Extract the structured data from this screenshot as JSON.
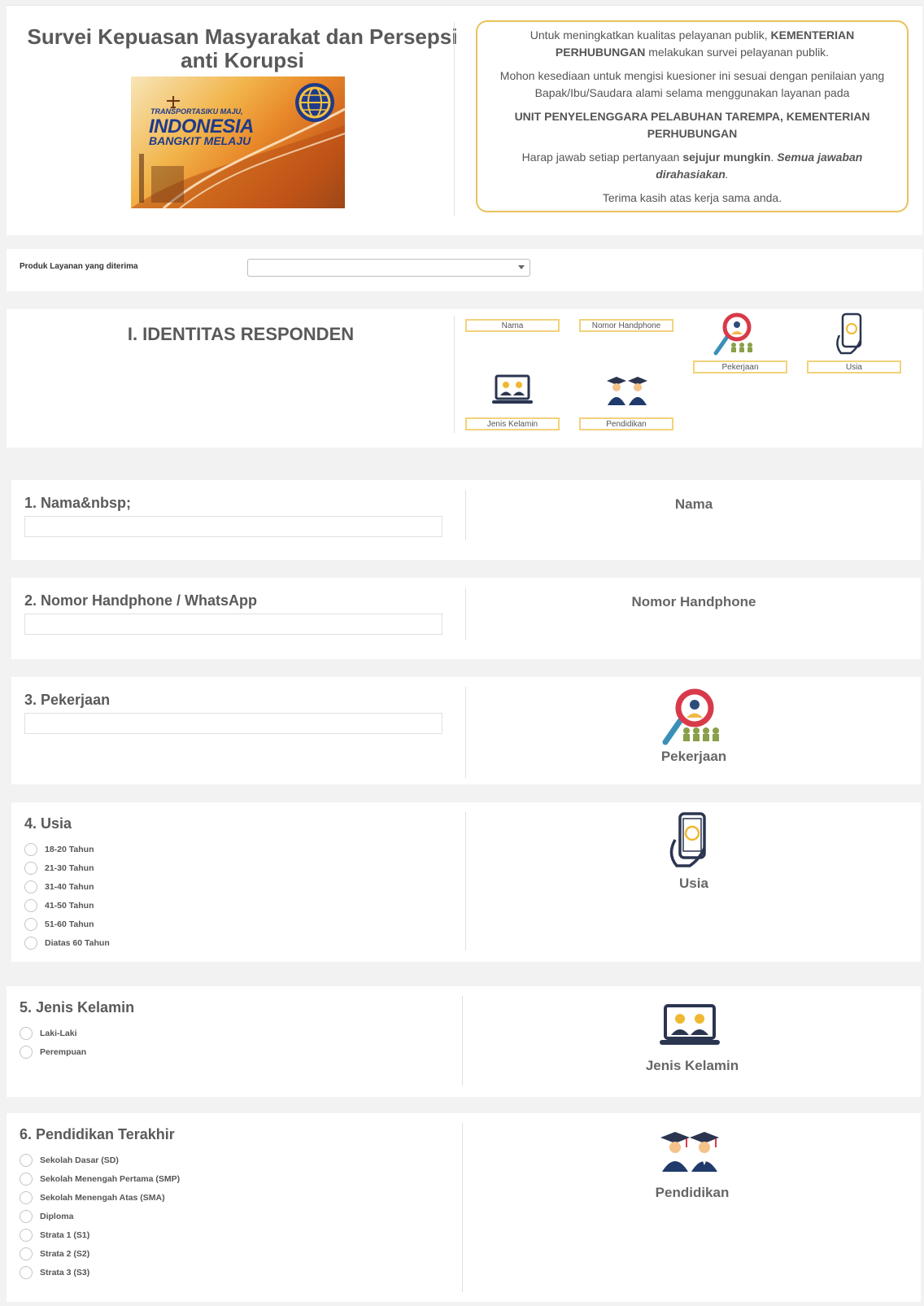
{
  "header": {
    "title_line1": "Survei Kepuasan Masyarakat dan Persepsi",
    "title_line2": "anti Korupsi",
    "banner_line1": "TRANSPORTASIKU MAJU,",
    "banner_line2": "INDONESIA",
    "banner_line3": "BANGKIT MELAJU",
    "info": {
      "p1_a": "Untuk meningkatkan kualitas pelayanan publik, ",
      "p1_b": "KEMENTERIAN PERHUBUNGAN",
      "p1_c": " melakukan survei pelayanan publik.",
      "p2": "Mohon kesediaan untuk mengisi kuesioner ini sesuai dengan penilaian yang Bapak/Ibu/Saudara alami selama menggunakan layanan pada",
      "p3": "UNIT PENYELENGGARA PELABUHAN TAREMPA, KEMENTERIAN PERHUBUNGAN",
      "p4_a": "Harap jawab setiap pertanyaan ",
      "p4_b": "sejujur mungkin",
      "p4_c": ". ",
      "p4_d": "Semua jawaban dirahasiakan",
      "p4_e": ".",
      "p5": "Terima kasih atas kerja sama anda."
    }
  },
  "produk": {
    "label": "Produk Layanan yang diterima",
    "value": ""
  },
  "identitas": {
    "title": "I. IDENTITAS RESPONDEN",
    "tags": {
      "nama": "Nama",
      "hp": "Nomor Handphone",
      "pekerjaan": "Pekerjaan",
      "usia": "Usia",
      "jk": "Jenis Kelamin",
      "pendidikan": "Pendidikan"
    }
  },
  "questions": {
    "q1": {
      "title": "1. Nama&nbsp;",
      "side": "Nama",
      "value": ""
    },
    "q2": {
      "title": "2. Nomor Handphone / WhatsApp",
      "side": "Nomor Handphone",
      "value": ""
    },
    "q3": {
      "title": "3. Pekerjaan",
      "side": "Pekerjaan",
      "value": ""
    },
    "q4": {
      "title": "4. Usia",
      "side": "Usia",
      "options": [
        "18-20 Tahun",
        "21-30 Tahun",
        "31-40 Tahun",
        "41-50 Tahun",
        "51-60 Tahun",
        "Diatas 60 Tahun"
      ]
    },
    "q5": {
      "title": "5. Jenis Kelamin",
      "side": "Jenis Kelamin",
      "options": [
        "Laki-Laki",
        "Perempuan"
      ]
    },
    "q6": {
      "title": "6. Pendidikan Terakhir",
      "side": "Pendidikan",
      "options": [
        "Sekolah Dasar (SD)",
        "Sekolah Menengah Pertama (SMP)",
        "Sekolah Menengah Atas (SMA)",
        "Diploma",
        "Strata 1 (S1)",
        "Strata 2 (S2)",
        "Strata 3 (S3)"
      ]
    }
  },
  "colors": {
    "accent_border": "#e9c25a",
    "tag_border": "#f2d27a",
    "navy": "#1f2f5c"
  },
  "icons": [
    "search-people-icon",
    "phone-18-icon",
    "laptop-couple-icon",
    "graduates-icon",
    "globe-logo-icon"
  ]
}
